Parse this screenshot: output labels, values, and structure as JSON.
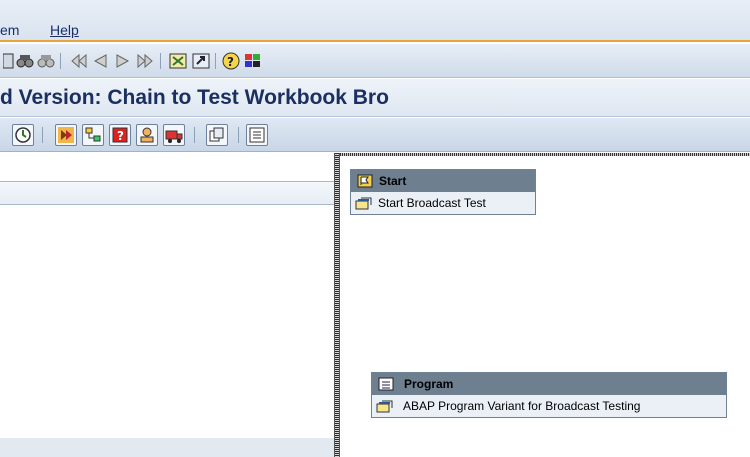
{
  "menu": {
    "items": [
      {
        "label": "em"
      },
      {
        "label": "Help"
      }
    ]
  },
  "standard_toolbar": {
    "icons": [
      "save-icon",
      "find-icon",
      "find-next-icon",
      "first-page-icon",
      "previous-page-icon",
      "next-page-icon",
      "last-page-icon",
      "create-session-icon",
      "shortcut-icon",
      "help-icon",
      "layout-icon"
    ]
  },
  "title": "d Version: Chain to Test Workbook Bro",
  "app_toolbar": {
    "icons": [
      "schedule-icon",
      "activate-icon",
      "planning-view-icon",
      "check-icon",
      "user-icon",
      "transport-icon",
      "copy-icon",
      "list-icon"
    ]
  },
  "nodes": {
    "start": {
      "header": "Start",
      "item": "Start Broadcast Test"
    },
    "program": {
      "header": "Program",
      "item": "ABAP Program Variant for Broadcast Testing"
    }
  },
  "colors": {
    "menu_accent": "#e8a33a",
    "title_text": "#1b3060",
    "node_header": "#6e7f90"
  }
}
